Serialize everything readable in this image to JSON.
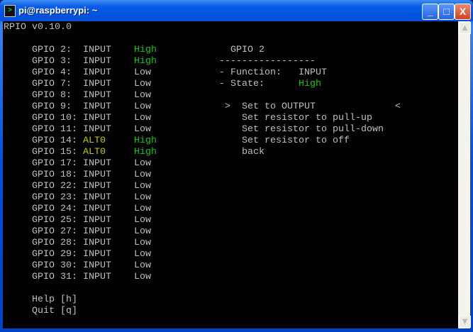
{
  "window": {
    "title": "pi@raspberrypi: ~",
    "minimize": "_",
    "maximize": "□",
    "close": "X"
  },
  "header": "RPIO v0.10.0",
  "colors": {
    "high": "#16c60c",
    "alt": "#c8c800",
    "text": "#c0c0c0"
  },
  "gpios": [
    {
      "name": "GPIO 2:",
      "function": "INPUT",
      "state": "High"
    },
    {
      "name": "GPIO 3:",
      "function": "INPUT",
      "state": "High"
    },
    {
      "name": "GPIO 4:",
      "function": "INPUT",
      "state": "Low"
    },
    {
      "name": "GPIO 7:",
      "function": "INPUT",
      "state": "Low"
    },
    {
      "name": "GPIO 8:",
      "function": "INPUT",
      "state": "Low"
    },
    {
      "name": "GPIO 9:",
      "function": "INPUT",
      "state": "Low"
    },
    {
      "name": "GPIO 10:",
      "function": "INPUT",
      "state": "Low"
    },
    {
      "name": "GPIO 11:",
      "function": "INPUT",
      "state": "Low"
    },
    {
      "name": "GPIO 14:",
      "function": "ALT0",
      "state": "High"
    },
    {
      "name": "GPIO 15:",
      "function": "ALT0",
      "state": "High"
    },
    {
      "name": "GPIO 17:",
      "function": "INPUT",
      "state": "Low"
    },
    {
      "name": "GPIO 18:",
      "function": "INPUT",
      "state": "Low"
    },
    {
      "name": "GPIO 22:",
      "function": "INPUT",
      "state": "Low"
    },
    {
      "name": "GPIO 23:",
      "function": "INPUT",
      "state": "Low"
    },
    {
      "name": "GPIO 24:",
      "function": "INPUT",
      "state": "Low"
    },
    {
      "name": "GPIO 25:",
      "function": "INPUT",
      "state": "Low"
    },
    {
      "name": "GPIO 27:",
      "function": "INPUT",
      "state": "Low"
    },
    {
      "name": "GPIO 28:",
      "function": "INPUT",
      "state": "Low"
    },
    {
      "name": "GPIO 29:",
      "function": "INPUT",
      "state": "Low"
    },
    {
      "name": "GPIO 30:",
      "function": "INPUT",
      "state": "Low"
    },
    {
      "name": "GPIO 31:",
      "function": "INPUT",
      "state": "Low"
    }
  ],
  "footer": {
    "help": "Help [h]",
    "quit": "Quit [q]"
  },
  "detail": {
    "title": "GPIO 2",
    "divider": "-----------------",
    "function_label": "- Function:",
    "function_value": "INPUT",
    "state_label": "- State:",
    "state_value": "High"
  },
  "menu": {
    "selected_marker": ">",
    "selected_end_marker": "<",
    "items": [
      "Set to OUTPUT",
      "Set resistor to pull-up",
      "Set resistor to pull-down",
      "Set resistor to off",
      "back"
    ]
  }
}
